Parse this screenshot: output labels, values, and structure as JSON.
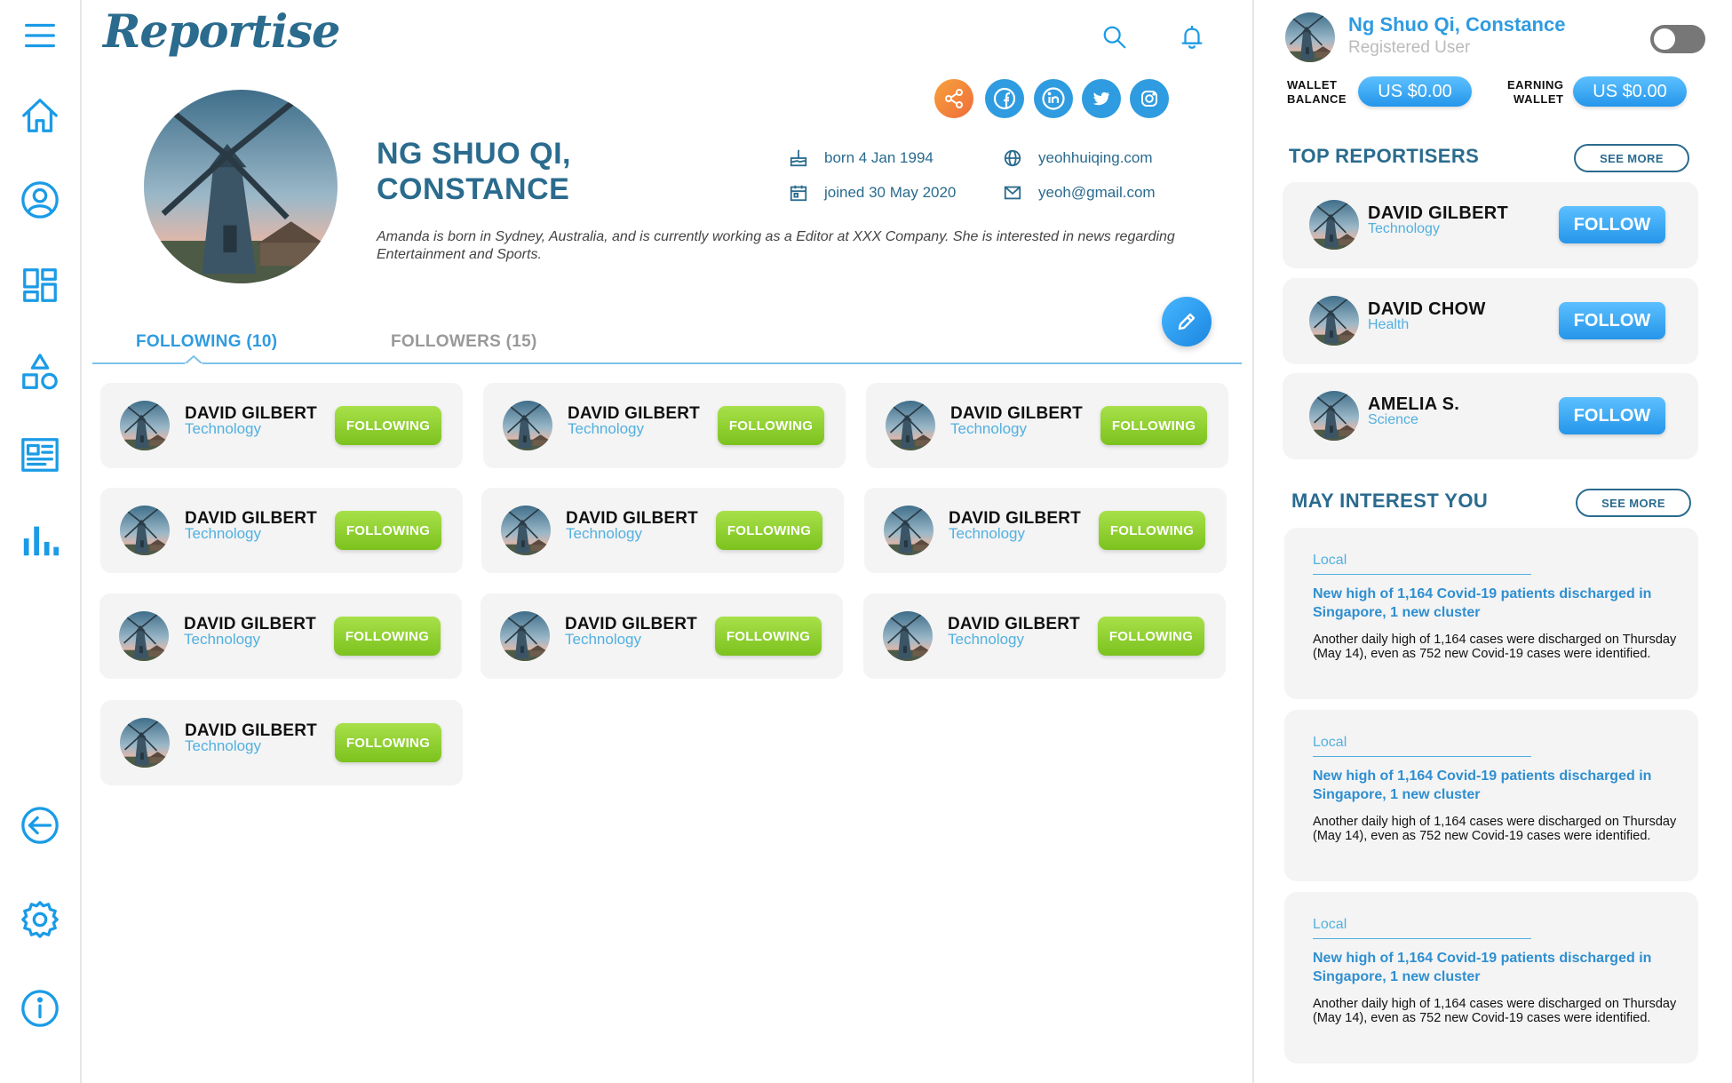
{
  "app": {
    "logo": "Reportise"
  },
  "sidebar": {
    "items": [
      {
        "icon": "menu-icon"
      },
      {
        "icon": "home-icon"
      },
      {
        "icon": "profile-icon"
      },
      {
        "icon": "dashboard-icon"
      },
      {
        "icon": "shapes-icon"
      },
      {
        "icon": "news-icon"
      },
      {
        "icon": "stats-icon"
      },
      {
        "icon": "logout-icon"
      },
      {
        "icon": "settings-icon"
      },
      {
        "icon": "info-icon"
      }
    ]
  },
  "header": {
    "search_icon": "search-icon",
    "bell_icon": "bell-icon"
  },
  "profile": {
    "name_line1": "NG SHUO QI,",
    "name_line2": "CONSTANCE",
    "born": "born 4 Jan 1994",
    "joined": "joined 30 May 2020",
    "website": "yeohhuiqing.com",
    "email": "yeoh@gmail.com",
    "bio": "Amanda is born in Sydney, Australia, and is currently working as a Editor at XXX Company. She is interested in news regarding Entertainment and Sports.",
    "social": [
      "share-icon",
      "facebook-icon",
      "linkedin-icon",
      "twitter-icon",
      "instagram-icon"
    ]
  },
  "tabs": {
    "following": "FOLLOWING (10)",
    "followers": "FOLLOWERS (15)"
  },
  "following": [
    {
      "name": "DAVID GILBERT",
      "category": "Technology",
      "button": "FOLLOWING"
    },
    {
      "name": "DAVID GILBERT",
      "category": "Technology",
      "button": "FOLLOWING"
    },
    {
      "name": "DAVID GILBERT",
      "category": "Technology",
      "button": "FOLLOWING"
    },
    {
      "name": "DAVID GILBERT",
      "category": "Technology",
      "button": "FOLLOWING"
    },
    {
      "name": "DAVID GILBERT",
      "category": "Technology",
      "button": "FOLLOWING"
    },
    {
      "name": "DAVID GILBERT",
      "category": "Technology",
      "button": "FOLLOWING"
    },
    {
      "name": "DAVID GILBERT",
      "category": "Technology",
      "button": "FOLLOWING"
    },
    {
      "name": "DAVID GILBERT",
      "category": "Technology",
      "button": "FOLLOWING"
    },
    {
      "name": "DAVID GILBERT",
      "category": "Technology",
      "button": "FOLLOWING"
    },
    {
      "name": "DAVID GILBERT",
      "category": "Technology",
      "button": "FOLLOWING"
    }
  ],
  "user": {
    "name": "Ng Shuo Qi, Constance",
    "role": "Registered User"
  },
  "wallet": {
    "balance_label_1": "WALLET",
    "balance_label_2": "BALANCE",
    "balance_value": "US $0.00",
    "earning_label_1": "EARNING",
    "earning_label_2": "WALLET",
    "earning_value": "US $0.00"
  },
  "top_reportisers": {
    "title": "TOP REPORTISERS",
    "see_more": "SEE MORE",
    "items": [
      {
        "name": "DAVID GILBERT",
        "category": "Technology",
        "button": "FOLLOW"
      },
      {
        "name": "DAVID CHOW",
        "category": "Health",
        "button": "FOLLOW"
      },
      {
        "name": "AMELIA S.",
        "category": "Science",
        "button": "FOLLOW"
      }
    ]
  },
  "interest": {
    "title": "MAY INTEREST YOU",
    "see_more": "SEE MORE",
    "items": [
      {
        "tag": "Local",
        "title": "New high of 1,164 Covid-19 patients discharged in Singapore, 1 new cluster",
        "body": "Another daily high of 1,164 cases were discharged on Thursday (May 14), even as 752 new Covid-19 cases were identified."
      },
      {
        "tag": "Local",
        "title": "New high of 1,164 Covid-19 patients discharged in Singapore, 1 new cluster",
        "body": "Another daily high of 1,164 cases were discharged on Thursday (May 14), even as 752 new Covid-19 cases were identified."
      },
      {
        "tag": "Local",
        "title": "New high of 1,164 Covid-19 patients discharged in Singapore, 1 new cluster",
        "body": "Another daily high of 1,164 cases were discharged on Thursday (May 14), even as 752 new Covid-19 cases were identified."
      }
    ]
  },
  "colors": {
    "accent": "#1a9be6",
    "title": "#2a6b8e",
    "green": "#8fd12f",
    "card": "#f4f4f4"
  }
}
